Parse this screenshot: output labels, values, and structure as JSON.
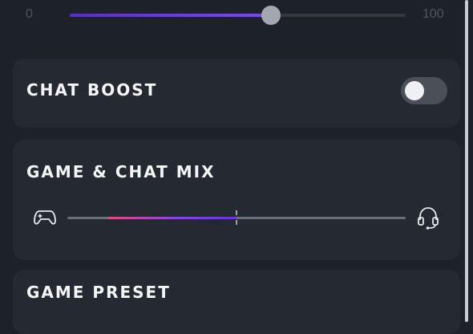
{
  "volume_slider": {
    "min_label": "0",
    "max_label": "100",
    "value": 60
  },
  "chat_boost": {
    "title": "CHAT BOOST",
    "enabled": false
  },
  "game_chat_mix": {
    "title": "GAME & CHAT MIX",
    "mix_fill_start": 0.12,
    "mix_fill_end": 0.5,
    "icons": {
      "left": "gamepad-icon",
      "right": "headset-icon"
    }
  },
  "game_preset": {
    "title": "GAME PRESET"
  },
  "colors": {
    "accent": "#7a46ff",
    "mix_gradient_start": "#ff3e78",
    "card_bg": "#252a32",
    "page_bg": "#1d2128"
  }
}
